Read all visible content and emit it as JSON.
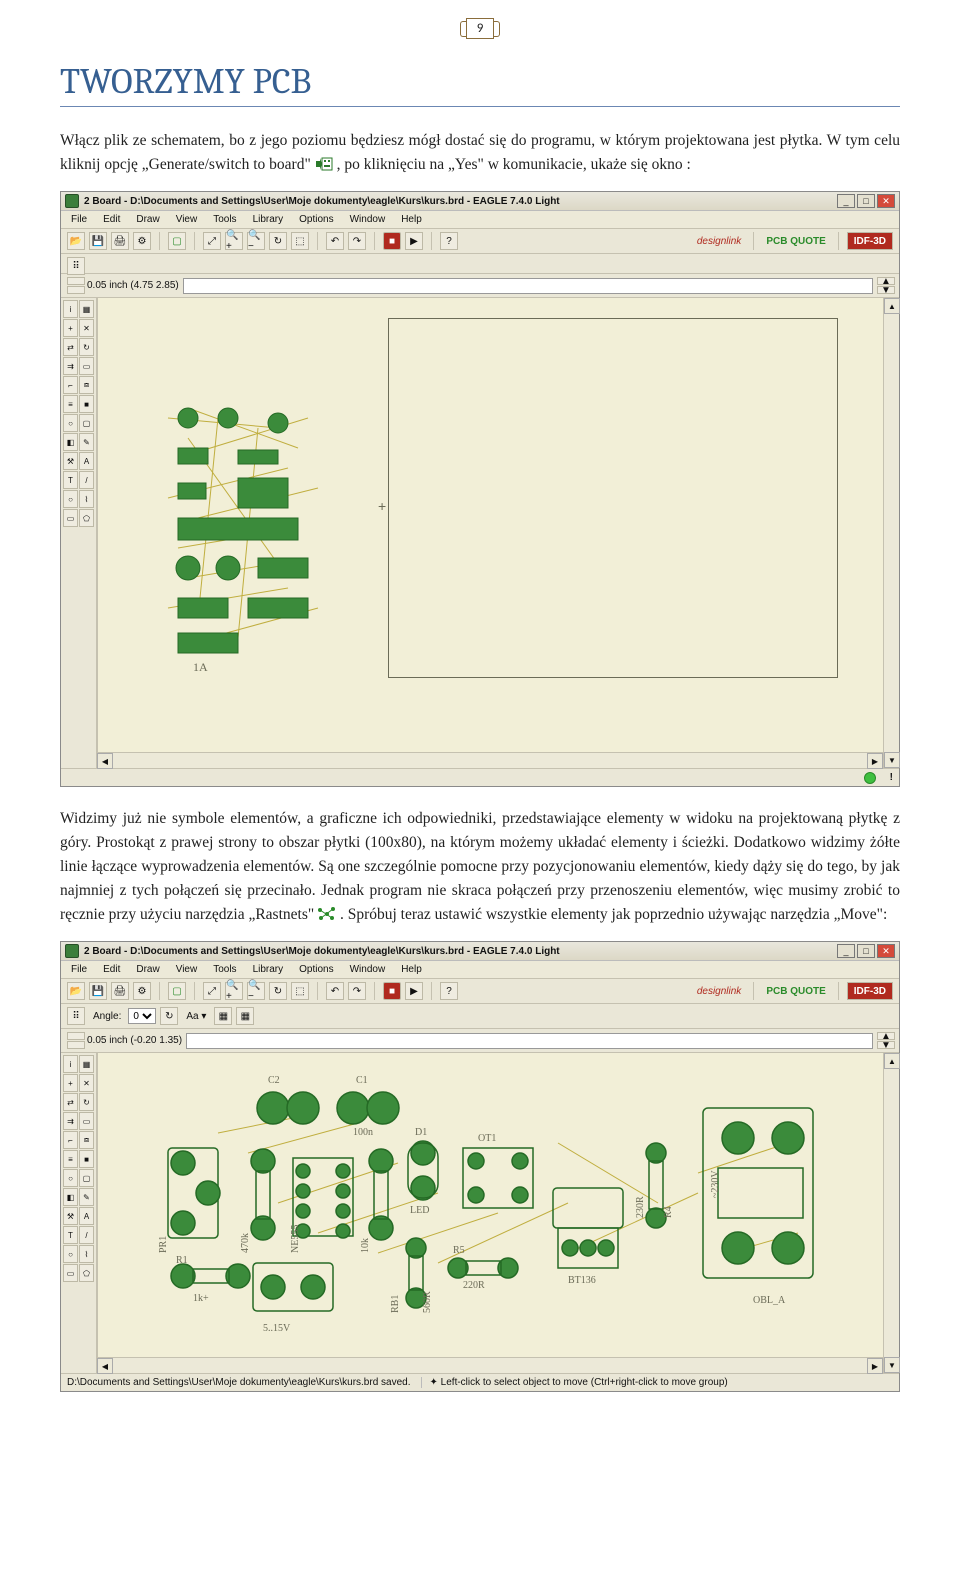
{
  "page_number": "9",
  "heading": "TWORZYMY PCB",
  "para1": "Włącz plik ze schematem, bo z jego poziomu będziesz mógł dostać się do programu, w którym projektowana jest płytka. W tym celu kliknij opcję „Generate/switch to board\" ",
  "para1_after": ", po kliknięciu na „Yes\" w komunikacie, ukaże się okno :",
  "para2_a": "Widzimy już nie symbole elementów, a graficzne ich odpowiedniki, przedstawiające elementy w widoku na projektowaną płytkę z góry. Prostokąt z prawej strony to obszar płytki (100x80), na którym możemy układać elementy i ścieżki. Dodatkowo widzimy żółte linie łączące wyprowadzenia elementów. Są one szczególnie pomocne przy pozycjonowaniu elementów, kiedy dąży się do tego, by jak najmniej z tych połączeń się przecinało. Jednak program nie skraca połączeń przy przenoszeniu elementów, więc musimy zrobić to ręcznie przy użyciu narzędzia „Rastnets\" ",
  "para2_b": ". Spróbuj teraz ustawić wszystkie elementy jak poprzednio używając narzędzia „Move\":",
  "app": {
    "title": "2 Board - D:\\Documents and Settings\\User\\Moje dokumenty\\eagle\\Kurs\\kurs.brd - EAGLE 7.4.0 Light",
    "menu": [
      "File",
      "Edit",
      "Draw",
      "View",
      "Tools",
      "Library",
      "Options",
      "Window",
      "Help"
    ],
    "grid_text": "0.05 inch (4.75 2.85)",
    "grid_text2": "0.05 inch (-0.20 1.35)",
    "design_link": "designlink",
    "pcb_quote": "PCB QUOTE",
    "idf": "IDF-3D",
    "angle_label": "Angle:",
    "angle_value": "0",
    "status2_left": "D:\\Documents and Settings\\User\\Moje dokumenty\\eagle\\Kurs\\kurs.brd saved.",
    "status2_right": "Left-click to select object to move (Ctrl+right-click to move group)"
  },
  "tool_icons": [
    "i",
    "▦",
    "+",
    "✕",
    "⇄",
    "↻",
    "⇉",
    "▭",
    "⌐",
    "⧈",
    "≡",
    "■",
    "○",
    "▢",
    "◧",
    "✎",
    "⚒",
    "A",
    "T",
    "/",
    "○",
    "⌇"
  ],
  "comp_labels1": {
    "f1": "1A"
  },
  "comp_labels2": {
    "c2": "C2",
    "c1": "C1",
    "c1v": "100n",
    "pr1": "PR1",
    "r470k": "470k",
    "ne555": "NE555",
    "r10k": "10k",
    "d1": "D1",
    "led": "LED",
    "ot1": "OT1",
    "r1": "R1",
    "r1v": "1k+",
    "v": "5..15V",
    "rb1": "RB1",
    "rb1v": "560R",
    "r5": "R5",
    "r5v": "220R",
    "bt136": "BT136",
    "r4": "R4",
    "r4v": "230R",
    "obl": "OBL_A",
    "v230": "~230V"
  }
}
